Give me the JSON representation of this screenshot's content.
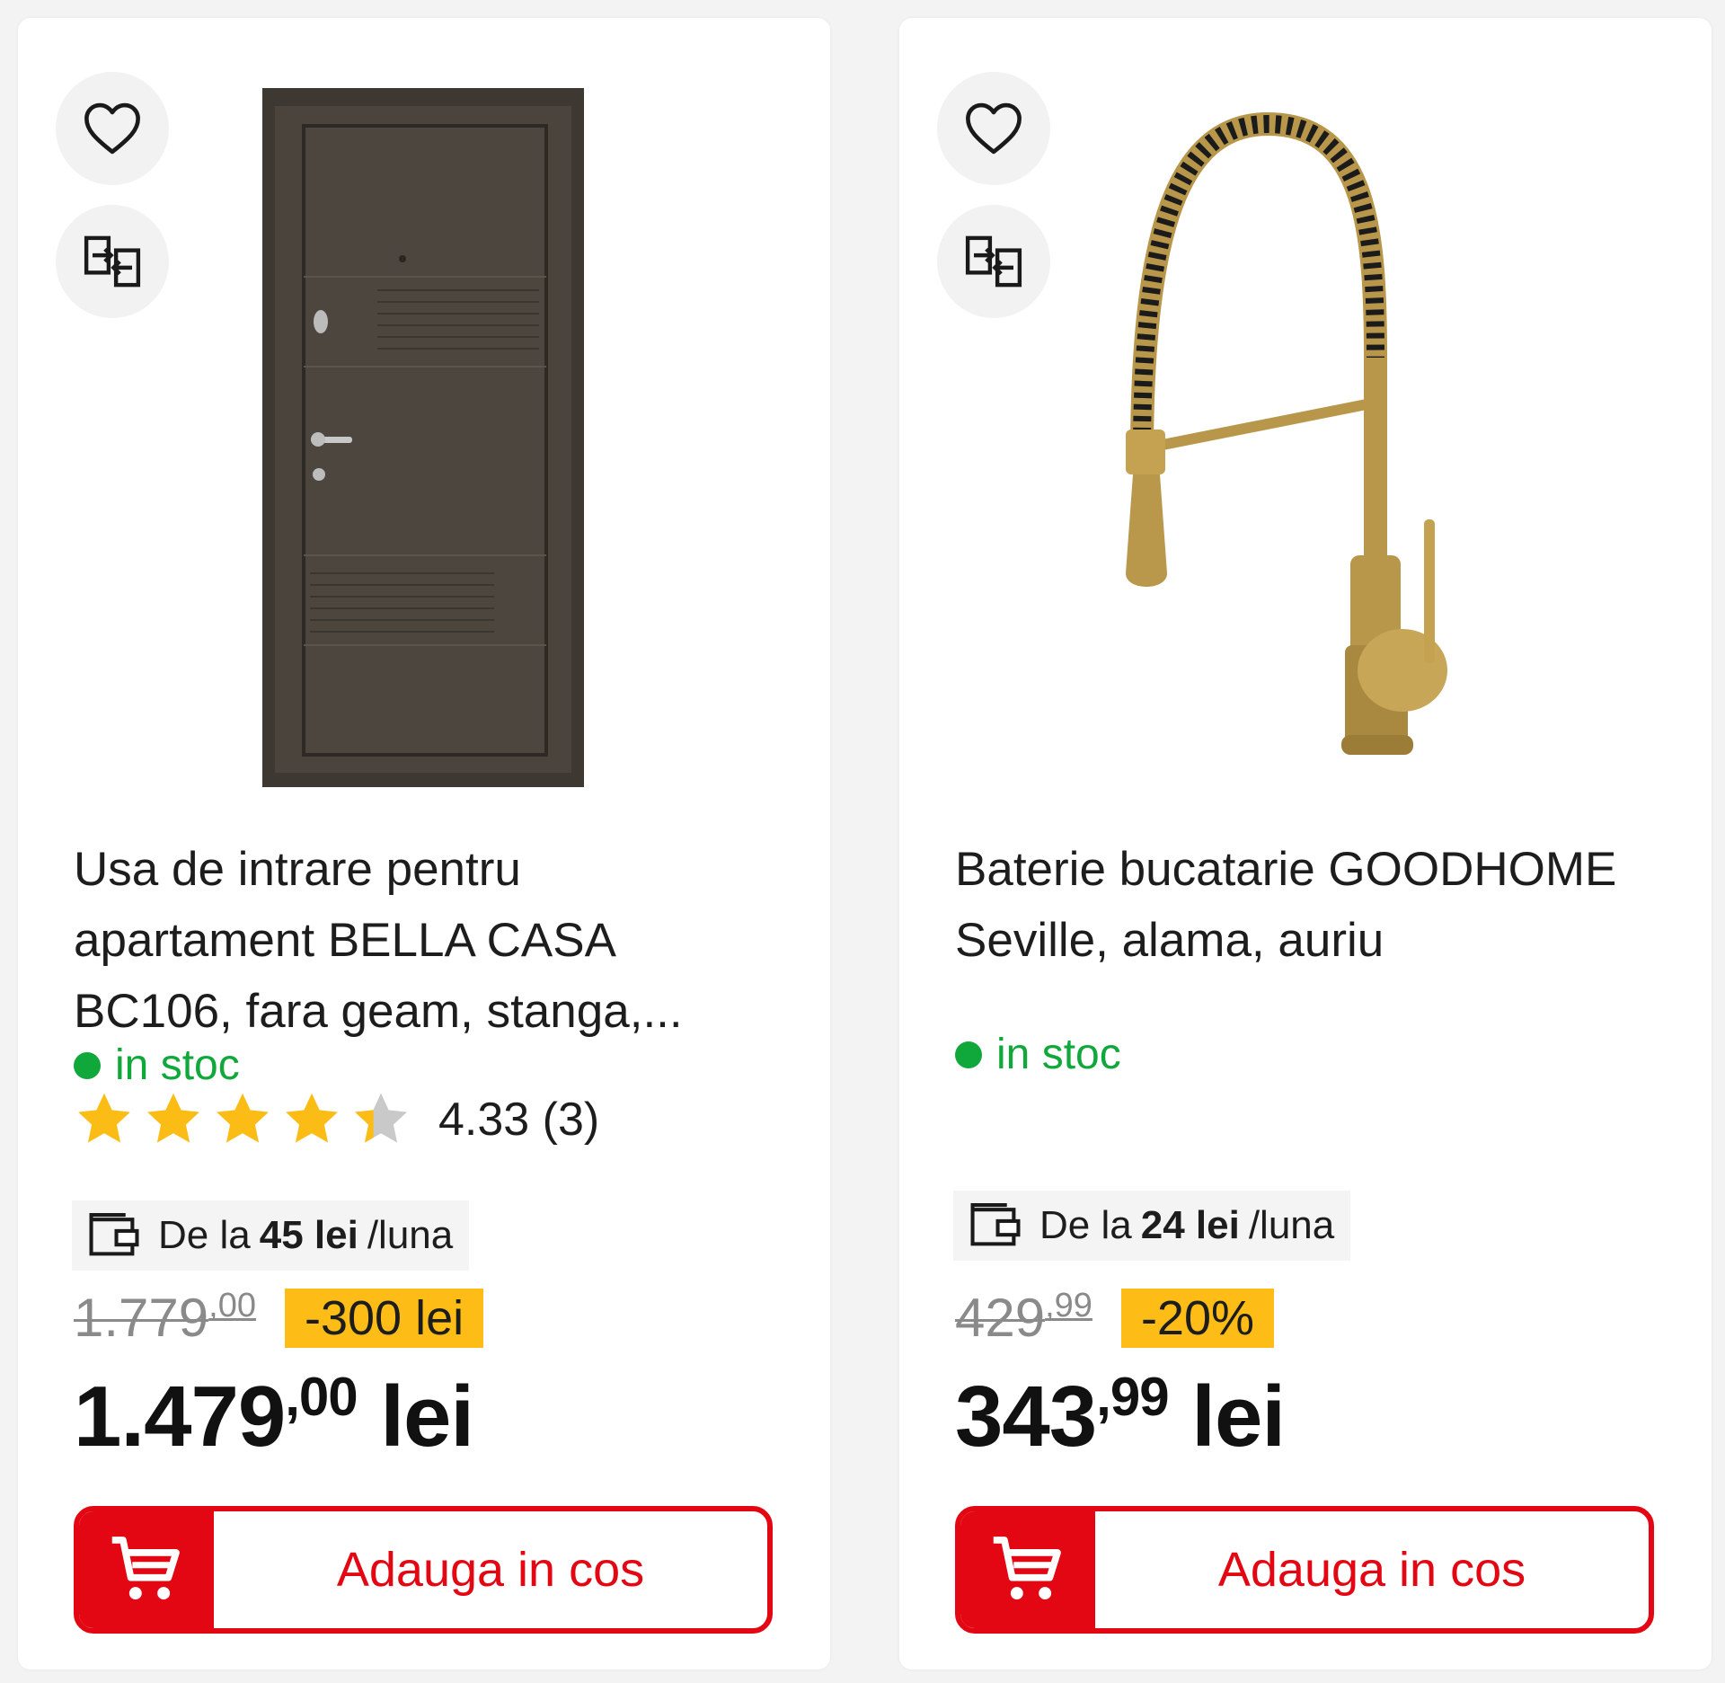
{
  "colors": {
    "accent": "#e30613",
    "stock_green": "#11a83b",
    "discount_yellow": "#fdbc16",
    "star_gold": "#fbbd15",
    "star_gray": "#c9c9c9"
  },
  "products": [
    {
      "image_icon": "entrance-door-image",
      "title": "Usa de intrare pentru apartament BELLA CASA BC106, fara geam, stanga,...",
      "stock": "in stoc",
      "rating_value": "4.33 (3)",
      "rating": 4.33,
      "installment": {
        "prefix": "De la",
        "amount": "45 lei",
        "suffix": "/luna"
      },
      "old_price": {
        "whole": "1.779",
        "decimal": ",00"
      },
      "discount": "-300 lei",
      "price": {
        "whole": "1.479",
        "decimal": ",00",
        "currency": "lei"
      },
      "cta": "Adauga in cos"
    },
    {
      "image_icon": "kitchen-faucet-image",
      "title": "Baterie bucatarie GOODHOME Seville, alama, auriu",
      "stock": "in stoc",
      "installment": {
        "prefix": "De la",
        "amount": "24 lei",
        "suffix": "/luna"
      },
      "old_price": {
        "whole": "429",
        "decimal": ",99"
      },
      "discount": "-20%",
      "price": {
        "whole": "343",
        "decimal": ",99",
        "currency": "lei"
      },
      "cta": "Adauga in cos"
    }
  ]
}
